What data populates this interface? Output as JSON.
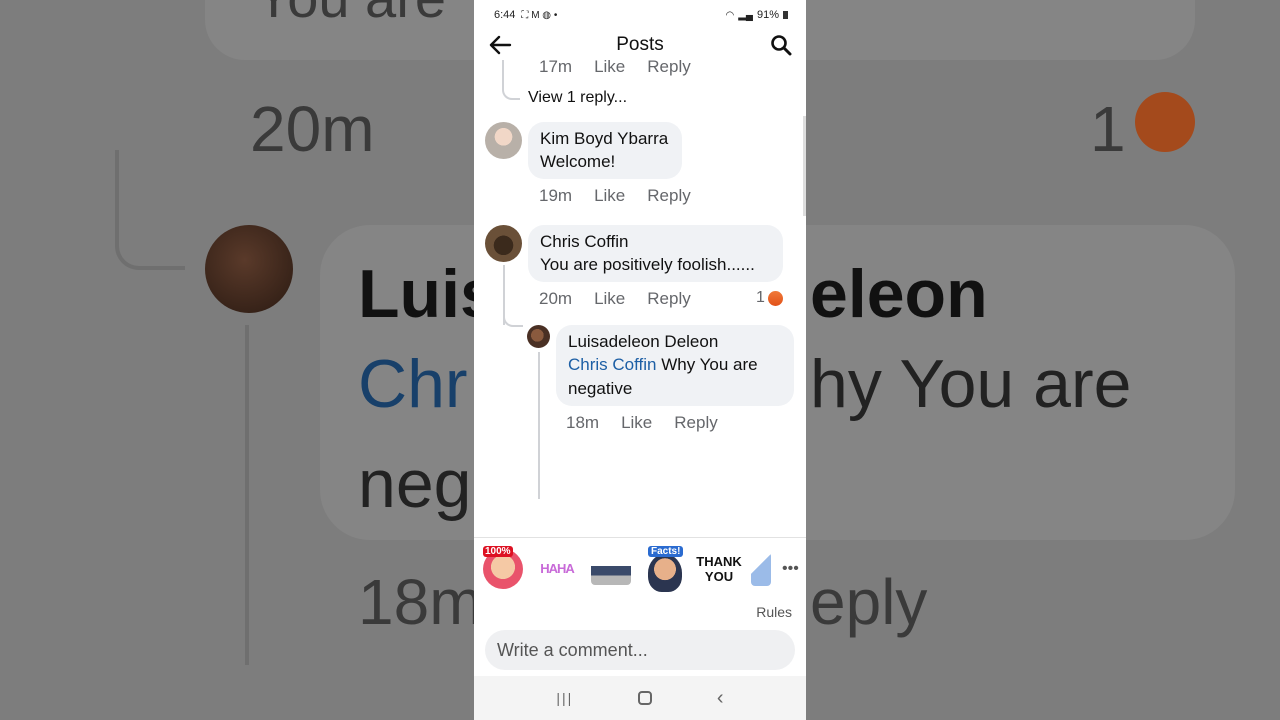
{
  "status_bar": {
    "time": "6:44",
    "battery": "91%"
  },
  "header": {
    "title": "Posts"
  },
  "comments": {
    "prev": {
      "time": "17m",
      "like": "Like",
      "reply": "Reply",
      "view_replies": "View 1 reply..."
    },
    "kim": {
      "author": "Kim Boyd Ybarra",
      "text": "Welcome!",
      "time": "19m",
      "like": "Like",
      "reply": "Reply"
    },
    "chris": {
      "author": "Chris Coffin",
      "text": "You are positively foolish......",
      "time": "20m",
      "like": "Like",
      "reply": "Reply",
      "reaction_count": "1",
      "reaction_icon": "angry-emoji-icon"
    },
    "luis": {
      "author": "Luisadeleon Deleon",
      "mention": "Chris Coffin",
      "text_line1": " Why You are",
      "text_line2": "negative",
      "time": "18m",
      "like": "Like",
      "reply": "Reply"
    }
  },
  "stickers": [
    {
      "name": "sticker-100",
      "label": "100%"
    },
    {
      "name": "sticker-haha",
      "label": "HAHA"
    },
    {
      "name": "sticker-desk",
      "label": ""
    },
    {
      "name": "sticker-facts",
      "label": "Facts!"
    },
    {
      "name": "sticker-thank-you",
      "label": "THANK YOU"
    }
  ],
  "rules_label": "Rules",
  "composer": {
    "placeholder": "Write a comment..."
  },
  "background_zoom": {
    "line1": "You are",
    "line1b": "foolish......",
    "time_a": "20m",
    "time_a_suffix": "L",
    "count": "1",
    "name_a": "Luis",
    "name_b": "eleon",
    "mention": "Chr",
    "text_b": "hy You are",
    "line_neg": "neg",
    "time_b": "18m",
    "reply_b": "eply"
  },
  "colors": {
    "accent": "#1d5fa5",
    "bubble": "#f0f2f5",
    "meta": "#65676b"
  }
}
